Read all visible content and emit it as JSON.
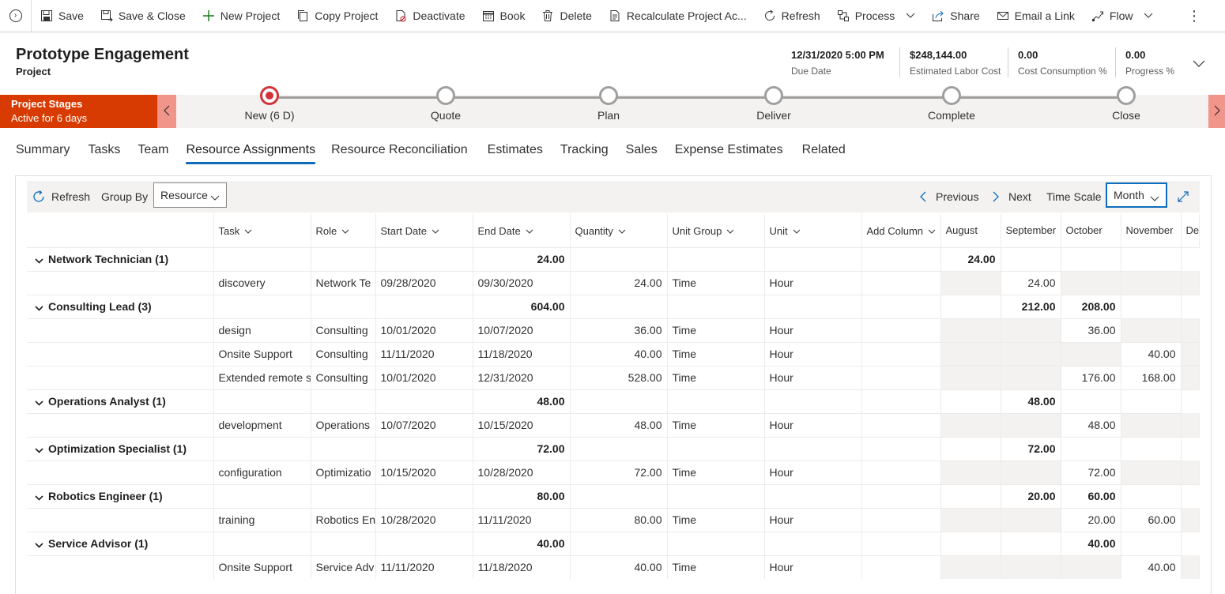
{
  "command_bar": {
    "items": [
      {
        "label": "Save",
        "icon": "save-icon"
      },
      {
        "label": "Save & Close",
        "icon": "save-close-icon"
      },
      {
        "label": "New Project",
        "icon": "plus-icon"
      },
      {
        "label": "Copy Project",
        "icon": "copy-icon"
      },
      {
        "label": "Deactivate",
        "icon": "deactivate-icon"
      },
      {
        "label": "Book",
        "icon": "calendar-icon"
      },
      {
        "label": "Delete",
        "icon": "trash-icon"
      },
      {
        "label": "Recalculate Project Ac...",
        "icon": "document-icon"
      },
      {
        "label": "Refresh",
        "icon": "refresh-icon"
      },
      {
        "label": "Process",
        "icon": "process-icon"
      },
      {
        "label": "Share",
        "icon": "share-icon"
      },
      {
        "label": "Email a Link",
        "icon": "email-icon"
      },
      {
        "label": "Flow",
        "icon": "flow-icon"
      }
    ],
    "more": "⋮"
  },
  "header": {
    "title": "Prototype Engagement",
    "entity": "Project",
    "fields": [
      {
        "value": "12/31/2020 5:00 PM",
        "label": "Due Date"
      },
      {
        "value": "$248,144.00",
        "label": "Estimated Labor Cost"
      },
      {
        "value": "0.00",
        "label": "Cost Consumption %"
      },
      {
        "value": "0.00",
        "label": "Progress %"
      }
    ]
  },
  "process": {
    "name": "Project Stages",
    "status": "Active for 6 days",
    "stages": [
      {
        "label": "New  (6 D)",
        "active": true
      },
      {
        "label": "Quote",
        "active": false
      },
      {
        "label": "Plan",
        "active": false
      },
      {
        "label": "Deliver",
        "active": false
      },
      {
        "label": "Complete",
        "active": false
      },
      {
        "label": "Close",
        "active": false
      }
    ],
    "accent": "#d83b01"
  },
  "tabs": [
    "Summary",
    "Tasks",
    "Team",
    "Resource Assignments",
    "Resource Reconciliation",
    "Estimates",
    "Tracking",
    "Sales",
    "Expense Estimates",
    "Related"
  ],
  "active_tab": "Resource Assignments",
  "toolbar": {
    "refresh": "Refresh",
    "group_by_label": "Group By",
    "group_by_value": "Resource",
    "previous": "Previous",
    "next": "Next",
    "time_scale_label": "Time Scale",
    "time_scale_value": "Month"
  },
  "grid": {
    "columns": [
      "Task",
      "Role",
      "Start Date",
      "End Date",
      "Quantity",
      "Unit Group",
      "Unit",
      "Add Column",
      "August",
      "September",
      "October",
      "November",
      "Dec"
    ],
    "groups": [
      {
        "name": "Network Technician (1)",
        "quantity": "24.00",
        "months": [
          "",
          "24.00",
          "",
          "",
          ""
        ],
        "rows": [
          {
            "task": "discovery",
            "role": "Network Te",
            "start": "09/28/2020",
            "end": "09/30/2020",
            "quantity": "24.00",
            "unit_group": "Time",
            "unit": "Hour",
            "months": [
              "",
              "24.00",
              "",
              "",
              ""
            ]
          }
        ]
      },
      {
        "name": "Consulting Lead (3)",
        "quantity": "604.00",
        "months": [
          "",
          "",
          "212.00",
          "208.00",
          ""
        ],
        "rows": [
          {
            "task": "design",
            "role": "Consulting",
            "start": "10/01/2020",
            "end": "10/07/2020",
            "quantity": "36.00",
            "unit_group": "Time",
            "unit": "Hour",
            "months": [
              "",
              "",
              "36.00",
              "",
              ""
            ]
          },
          {
            "task": "Onsite Support",
            "role": "Consulting",
            "start": "11/11/2020",
            "end": "11/18/2020",
            "quantity": "40.00",
            "unit_group": "Time",
            "unit": "Hour",
            "months": [
              "",
              "",
              "",
              "40.00",
              ""
            ]
          },
          {
            "task": "Extended remote s",
            "role": "Consulting",
            "start": "10/01/2020",
            "end": "12/31/2020",
            "quantity": "528.00",
            "unit_group": "Time",
            "unit": "Hour",
            "months": [
              "",
              "",
              "176.00",
              "168.00",
              ""
            ]
          }
        ]
      },
      {
        "name": "Operations Analyst (1)",
        "quantity": "48.00",
        "months": [
          "",
          "",
          "48.00",
          "",
          ""
        ],
        "rows": [
          {
            "task": "development",
            "role": "Operations",
            "start": "10/07/2020",
            "end": "10/15/2020",
            "quantity": "48.00",
            "unit_group": "Time",
            "unit": "Hour",
            "months": [
              "",
              "",
              "48.00",
              "",
              ""
            ]
          }
        ]
      },
      {
        "name": "Optimization Specialist (1)",
        "quantity": "72.00",
        "months": [
          "",
          "",
          "72.00",
          "",
          ""
        ],
        "rows": [
          {
            "task": "configuration",
            "role": "Optimizatio",
            "start": "10/15/2020",
            "end": "10/28/2020",
            "quantity": "72.00",
            "unit_group": "Time",
            "unit": "Hour",
            "months": [
              "",
              "",
              "72.00",
              "",
              ""
            ]
          }
        ]
      },
      {
        "name": "Robotics Engineer (1)",
        "quantity": "80.00",
        "months": [
          "",
          "",
          "20.00",
          "60.00",
          ""
        ],
        "rows": [
          {
            "task": "training",
            "role": "Robotics En",
            "start": "10/28/2020",
            "end": "11/11/2020",
            "quantity": "80.00",
            "unit_group": "Time",
            "unit": "Hour",
            "months": [
              "",
              "",
              "20.00",
              "60.00",
              ""
            ]
          }
        ]
      },
      {
        "name": "Service Advisor (1)",
        "quantity": "40.00",
        "months": [
          "",
          "",
          "",
          "40.00",
          ""
        ],
        "rows": [
          {
            "task": "Onsite Support",
            "role": "Service Adv",
            "start": "11/11/2020",
            "end": "11/18/2020",
            "quantity": "40.00",
            "unit_group": "Time",
            "unit": "Hour",
            "months": [
              "",
              "",
              "",
              "40.00",
              ""
            ]
          }
        ]
      }
    ]
  }
}
